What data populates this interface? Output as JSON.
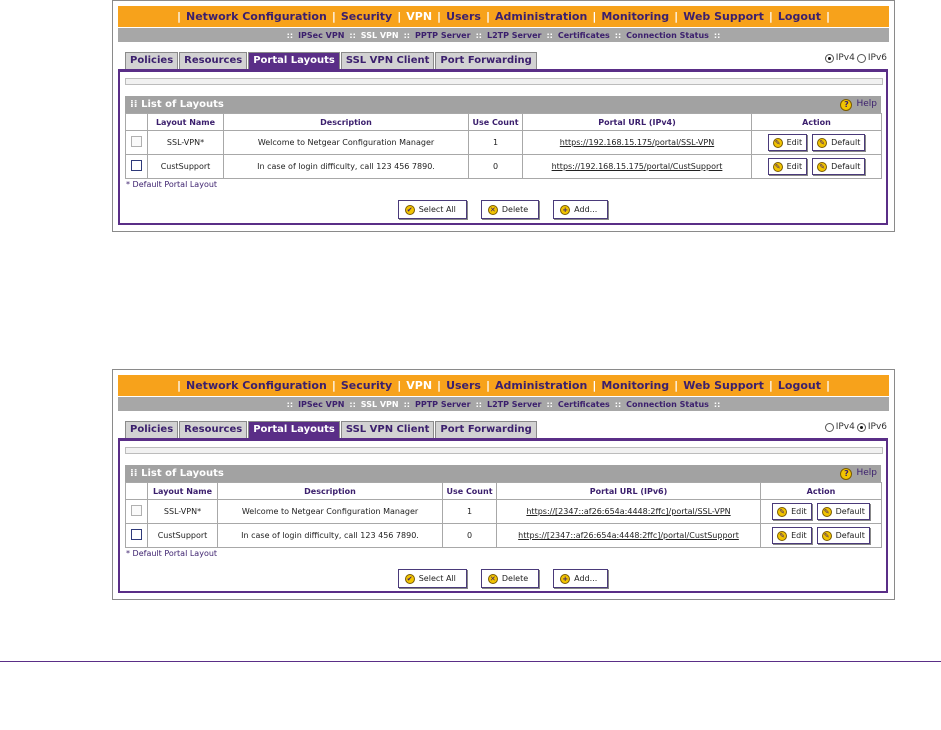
{
  "top_nav": [
    "Network Configuration",
    "Security",
    "VPN",
    "Users",
    "Administration",
    "Monitoring",
    "Web Support",
    "Logout"
  ],
  "top_nav_active": "VPN",
  "sub_nav": [
    "IPSec VPN",
    "SSL VPN",
    "PPTP Server",
    "L2TP Server",
    "Certificates",
    "Connection Status"
  ],
  "sub_nav_active": "SSL VPN",
  "tabs": [
    "Policies",
    "Resources",
    "Portal Layouts",
    "SSL VPN Client",
    "Port Forwarding"
  ],
  "active_tab": "Portal Layouts",
  "ip_options": [
    "IPv4",
    "IPv6"
  ],
  "list_title": "List of Layouts",
  "help_label": "Help",
  "col_headers": [
    "Layout Name",
    "Description",
    "Use Count",
    "Action"
  ],
  "default_note": "* Default Portal Layout",
  "buttons": {
    "select_all": "Select All",
    "delete": "Delete",
    "add": "Add...",
    "edit": "Edit",
    "default": "Default"
  },
  "screens": [
    {
      "selected_ip": "IPv4",
      "url_header": "Portal URL (IPv4)",
      "rows": [
        {
          "name": "SSL-VPN*",
          "description": "Welcome to Netgear Configuration Manager",
          "use_count": "1",
          "url": "https://192.168.15.175/portal/SSL-VPN"
        },
        {
          "name": "CustSupport",
          "description": "In case of login difficulty, call 123 456 7890.",
          "use_count": "0",
          "url": "https://192.168.15.175/portal/CustSupport"
        }
      ]
    },
    {
      "selected_ip": "IPv6",
      "url_header": "Portal URL (IPv6)",
      "rows": [
        {
          "name": "SSL-VPN*",
          "description": "Welcome to Netgear Configuration Manager",
          "use_count": "1",
          "url": "https://[2347::af26:654a:4448:2ffc]/portal/SSL-VPN"
        },
        {
          "name": "CustSupport",
          "description": "In case of login difficulty, call 123 456 7890.",
          "use_count": "0",
          "url": "https://[2347::af26:654a:4448:2ffc]/portal/CustSupport"
        }
      ]
    }
  ],
  "colors": {
    "accent_orange": "#f7a21b",
    "brand_purple": "#5a2e87",
    "sub_gray": "#a7a7a7",
    "header_gray": "#a2a2a2"
  }
}
